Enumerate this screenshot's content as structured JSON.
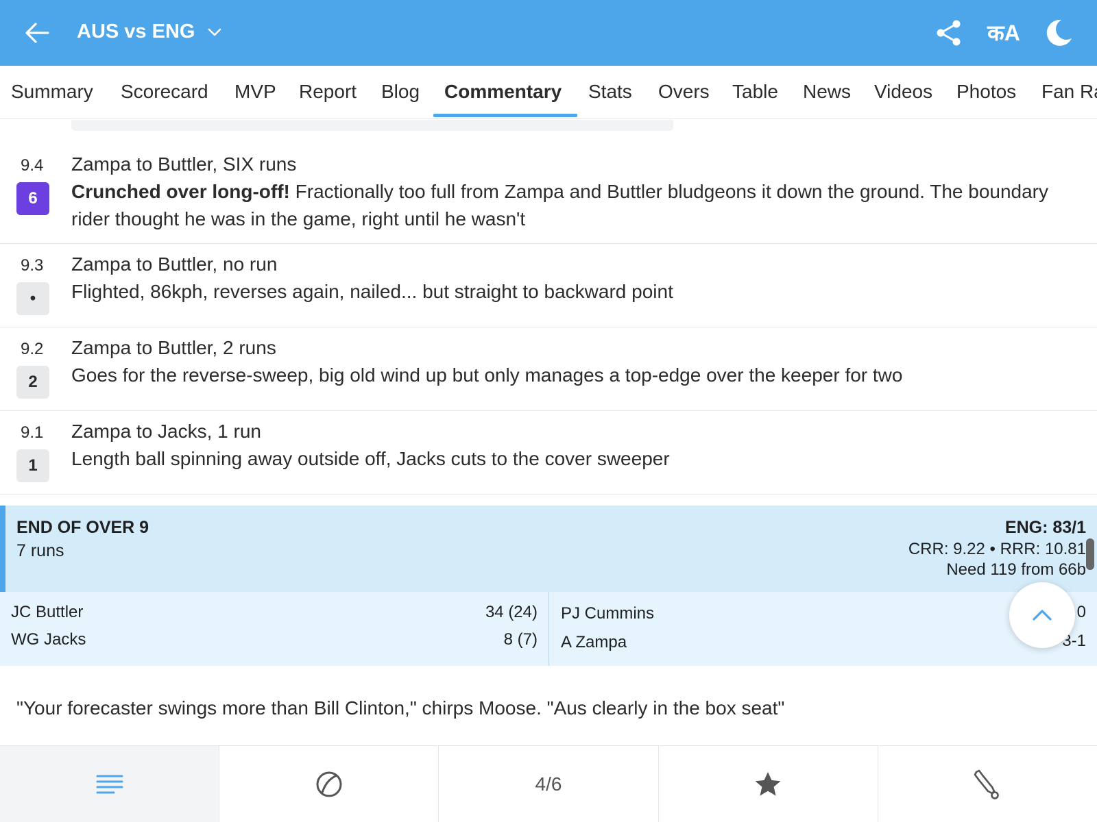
{
  "header": {
    "title": "AUS vs ENG",
    "lang_label": "कA",
    "color": "#4da6ea"
  },
  "tabs": [
    {
      "label": "Summary"
    },
    {
      "label": "Scorecard"
    },
    {
      "label": "MVP"
    },
    {
      "label": "Report"
    },
    {
      "label": "Blog"
    },
    {
      "label": "Commentary",
      "active": true
    },
    {
      "label": "Stats"
    },
    {
      "label": "Overs"
    },
    {
      "label": "Table"
    },
    {
      "label": "News"
    },
    {
      "label": "Videos"
    },
    {
      "label": "Photos"
    },
    {
      "label": "Fan Ra"
    }
  ],
  "commentary": [
    {
      "over": "9.4",
      "badge": "6",
      "headline": "Zampa to Buttler, SIX runs",
      "bold": "Crunched over long-off!",
      "text": " Fractionally too full from Zampa and Buttler bludgeons it down the ground. The boundary rider thought he was in the game, right until he wasn't"
    },
    {
      "over": "9.3",
      "badge": "•",
      "headline": "Zampa to Buttler, no run",
      "text": "Flighted, 86kph, reverses again, nailed... but straight to backward point"
    },
    {
      "over": "9.2",
      "badge": "2",
      "headline": "Zampa to Buttler, 2 runs",
      "text": "Goes for the reverse-sweep, big old wind up but only manages a top-edge over the keeper for two"
    },
    {
      "over": "9.1",
      "badge": "1",
      "headline": "Zampa to Jacks, 1 run",
      "text": "Length ball spinning away outside off, Jacks cuts to the cover sweeper"
    }
  ],
  "end_of_over": {
    "title": "END OF OVER 9",
    "runs": "7 runs",
    "score": "ENG: 83/1",
    "rates": "CRR: 9.22 • RRR: 10.81",
    "need": "Need 119 from 66b",
    "batters": [
      {
        "name": "JC Buttler",
        "score": "34 (24)"
      },
      {
        "name": "WG Jacks",
        "score": "8 (7)"
      }
    ],
    "bowlers": [
      {
        "name": "PJ Cummins",
        "figures": "0"
      },
      {
        "name": "A Zampa",
        "figures": "1-0-3-1"
      }
    ]
  },
  "quote": "\"Your forecaster swings more than Bill Clinton,\" chirps Moose. \"Aus clearly in the box seat\"",
  "bottom_bar": {
    "counter": "4/6"
  }
}
